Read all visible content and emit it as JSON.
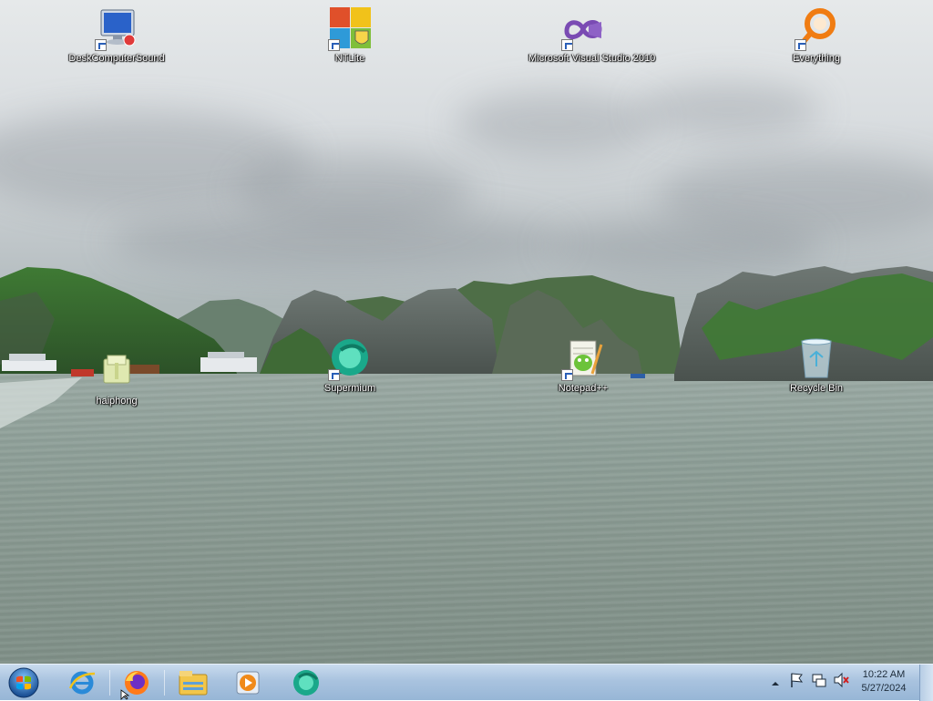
{
  "desktop": {
    "icons": [
      {
        "label": "DeskComputerSound",
        "icon": "computer-sound-icon",
        "shortcut": true
      },
      {
        "label": "NTLite",
        "icon": "ntlite-icon",
        "shortcut": true
      },
      {
        "label": "Microsoft Visual Studio 2010",
        "icon": "visual-studio-icon",
        "shortcut": true
      },
      {
        "label": "Everything",
        "icon": "everything-search-icon",
        "shortcut": true
      },
      {
        "label": "haiphong",
        "icon": "folder-zip-icon",
        "shortcut": false
      },
      {
        "label": "Supermium",
        "icon": "supermium-browser-icon",
        "shortcut": true
      },
      {
        "label": "Notepad++",
        "icon": "notepad-plus-plus-icon",
        "shortcut": true
      },
      {
        "label": "Recycle Bin",
        "icon": "recycle-bin-icon",
        "shortcut": false
      }
    ]
  },
  "taskbar": {
    "start": {
      "icon": "windows-start-orb-icon"
    },
    "pinned": [
      {
        "icon": "internet-explorer-icon"
      },
      {
        "icon": "firefox-icon"
      },
      {
        "icon": "file-explorer-icon"
      },
      {
        "icon": "media-player-icon"
      },
      {
        "icon": "supermium-browser-icon"
      }
    ],
    "tray": {
      "clock_time": "10:22 AM",
      "clock_date": "5/27/2024",
      "icons": [
        "show-hidden-icons-arrow",
        "action-center-flag-icon",
        "network-icon",
        "volume-muted-icon"
      ]
    }
  }
}
